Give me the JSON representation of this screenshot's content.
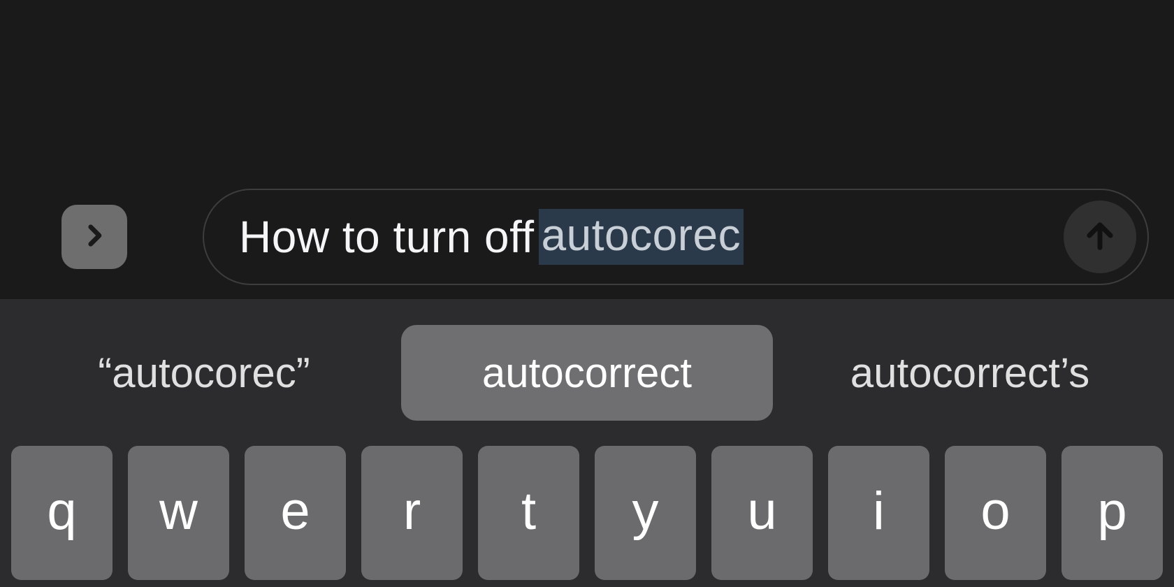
{
  "input": {
    "typed_prefix": "How to turn off",
    "highlighted_suffix": "autocorec"
  },
  "suggestions": [
    {
      "label": "“autocorec”",
      "selected": false
    },
    {
      "label": "autocorrect",
      "selected": true
    },
    {
      "label": "autocorrect’s",
      "selected": false
    }
  ],
  "keyboard": {
    "row1": [
      "q",
      "w",
      "e",
      "r",
      "t",
      "y",
      "u",
      "i",
      "o",
      "p"
    ]
  }
}
